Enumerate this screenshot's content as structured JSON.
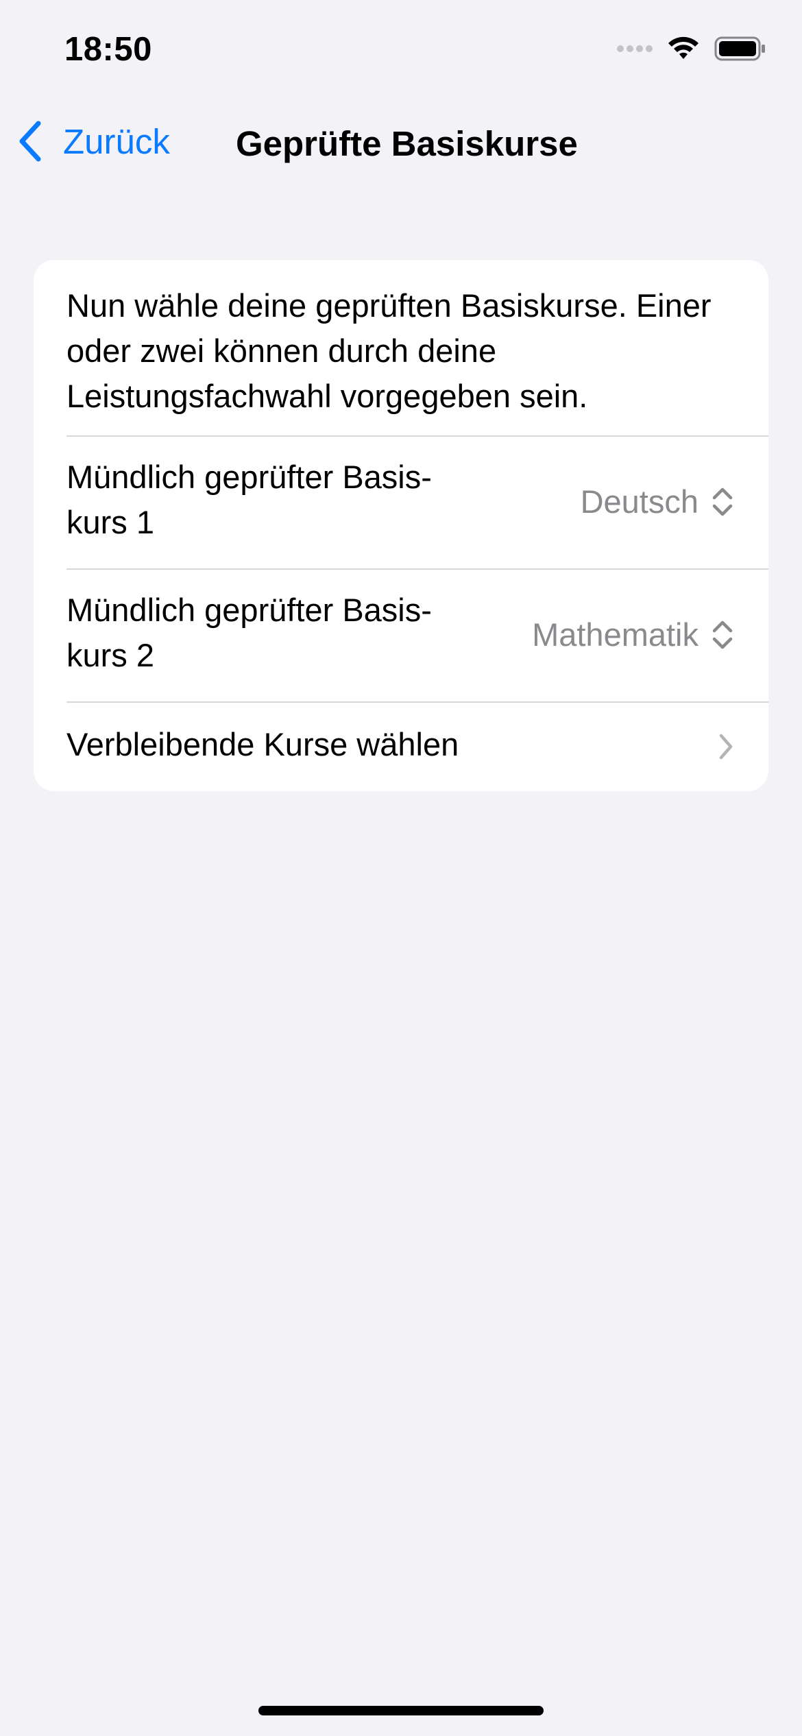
{
  "status_bar": {
    "time": "18:50",
    "icons": [
      "signal-icon",
      "wifi-icon",
      "battery-icon"
    ]
  },
  "nav": {
    "back_label": "Zurück",
    "title": "Geprüfte Basiskurse"
  },
  "card": {
    "intro": "Nun wähle deine geprüften Basiskurse. Einer oder zwei können durch deine Leistungsfachwahl vorgegeben sein.",
    "rows": [
      {
        "label_line1": "Mündlich geprüfter Basis-",
        "label_line2": "kurs 1",
        "value": "Deutsch"
      },
      {
        "label_line1": "Mündlich geprüfter Basis-",
        "label_line2": "kurs 2",
        "value": "Mathematik"
      },
      {
        "label": "Verbleibende Kurse wählen"
      }
    ]
  },
  "colors": {
    "accent": "#0a7aff",
    "background": "#f2f2f7",
    "secondary_text": "#8a8a8e"
  }
}
